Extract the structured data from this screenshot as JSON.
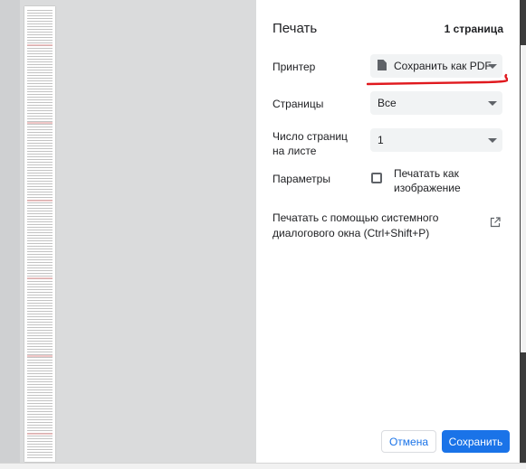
{
  "dialog": {
    "title": "Печать",
    "page_count": "1 страница"
  },
  "settings": {
    "printer": {
      "label": "Принтер",
      "value": "Сохранить как PDF",
      "icon": "document-icon",
      "annotation_color": "#e0191e"
    },
    "pages": {
      "label": "Страницы",
      "value": "Все"
    },
    "pages_per_sheet": {
      "label": "Число страниц на листе",
      "value": "1"
    },
    "options": {
      "label": "Параметры",
      "checkbox_label": "Печатать как изображение",
      "checked": false
    },
    "system_dialog": {
      "label": "Печатать с помощью системного диалогового окна (Ctrl+Shift+P)",
      "icon": "open-in-new-icon"
    }
  },
  "buttons": {
    "cancel": "Отмена",
    "save": "Сохранить"
  },
  "colors": {
    "accent": "#1a73e8",
    "select_bg": "#f1f3f4",
    "preview_bg": "#dadbdc"
  }
}
